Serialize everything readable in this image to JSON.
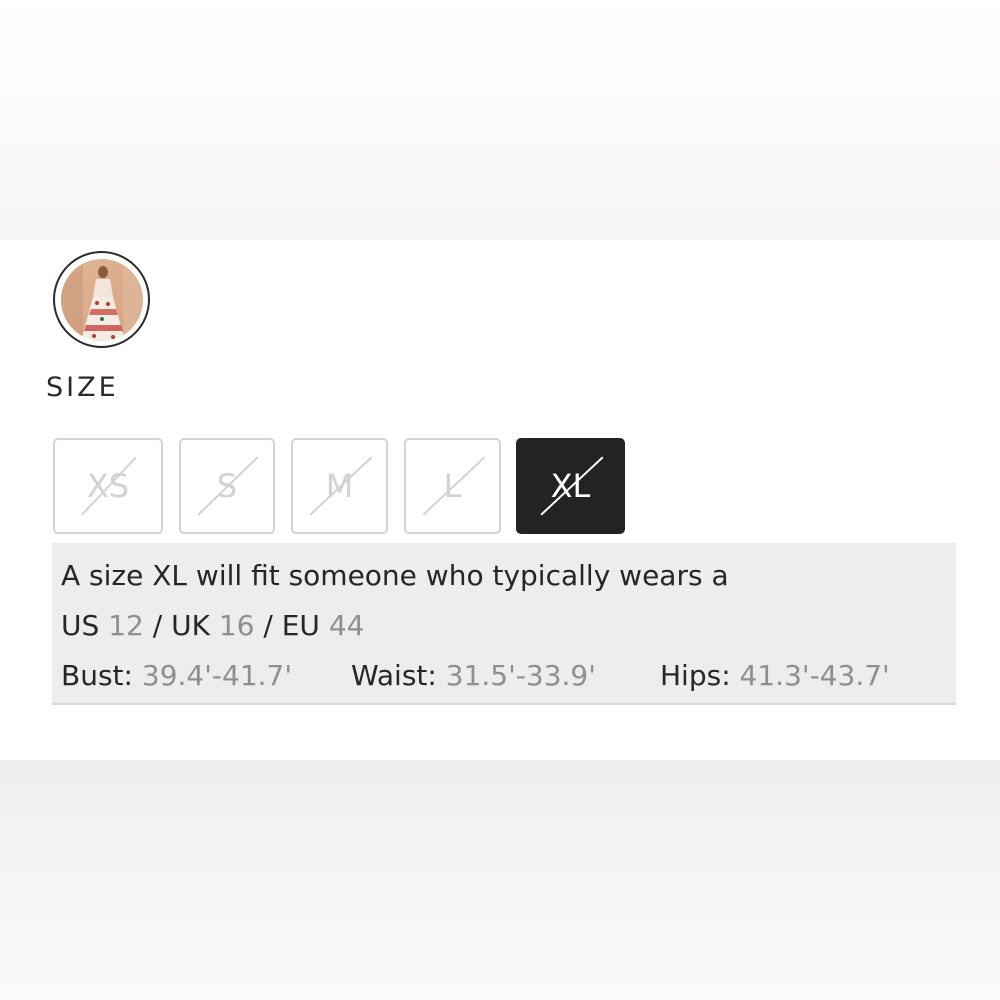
{
  "swatch": {
    "icon": "dress-thumbnail"
  },
  "size_section": {
    "heading": "SIZE",
    "options": [
      {
        "label": "XS",
        "selected": false
      },
      {
        "label": "S",
        "selected": false
      },
      {
        "label": "M",
        "selected": false
      },
      {
        "label": "L",
        "selected": false
      },
      {
        "label": "XL",
        "selected": true
      }
    ]
  },
  "fit_info": {
    "intro": "A size XL will fit someone who typically wears a",
    "conversions": {
      "us_label": "US",
      "us_value": "12",
      "sep1": "/",
      "uk_label": "UK",
      "uk_value": "16",
      "sep2": "/",
      "eu_label": "EU",
      "eu_value": "44"
    },
    "measurements": {
      "bust_label": "Bust:",
      "bust_value": "39.4'-41.7'",
      "waist_label": "Waist:",
      "waist_value": "31.5'-33.9'",
      "hips_label": "Hips:",
      "hips_value": "41.3'-43.7'"
    }
  },
  "colors": {
    "selected_bg": "#232323",
    "unavailable_text": "#d2d2d2",
    "info_bg": "#ededed",
    "muted_value": "#8f8f8f"
  }
}
